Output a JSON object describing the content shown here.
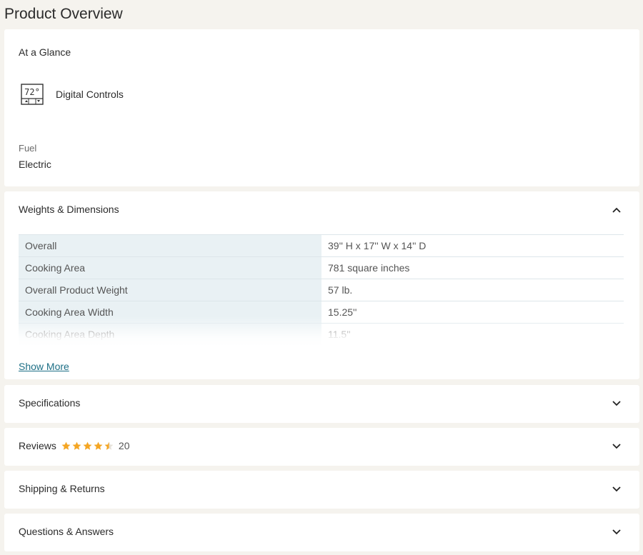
{
  "page": {
    "title": "Product Overview"
  },
  "glance": {
    "label": "At a Glance",
    "feature": {
      "icon": "thermostat-icon",
      "icon_text": "72°",
      "label": "Digital Controls"
    },
    "fuel_label": "Fuel",
    "fuel_value": "Electric"
  },
  "weights_dimensions": {
    "title": "Weights & Dimensions",
    "expanded": true,
    "rows": [
      {
        "key": "Overall",
        "value": "39'' H x 17'' W x 14'' D"
      },
      {
        "key": "Cooking Area",
        "value": "781 square inches"
      },
      {
        "key": "Overall Product Weight",
        "value": "57 lb."
      },
      {
        "key": "Cooking Area Width",
        "value": "15.25''"
      },
      {
        "key": "Cooking Area Depth",
        "value": "11.5''"
      }
    ],
    "show_more": "Show More"
  },
  "sections": {
    "specifications": {
      "title": "Specifications"
    },
    "reviews": {
      "title": "Reviews",
      "rating": 4.5,
      "count": "20"
    },
    "shipping": {
      "title": "Shipping & Returns"
    },
    "questions": {
      "title": "Questions & Answers"
    }
  },
  "colors": {
    "star": "#f5a623",
    "link": "#1d6f86",
    "table_key_bg": "#e9f1f4"
  }
}
